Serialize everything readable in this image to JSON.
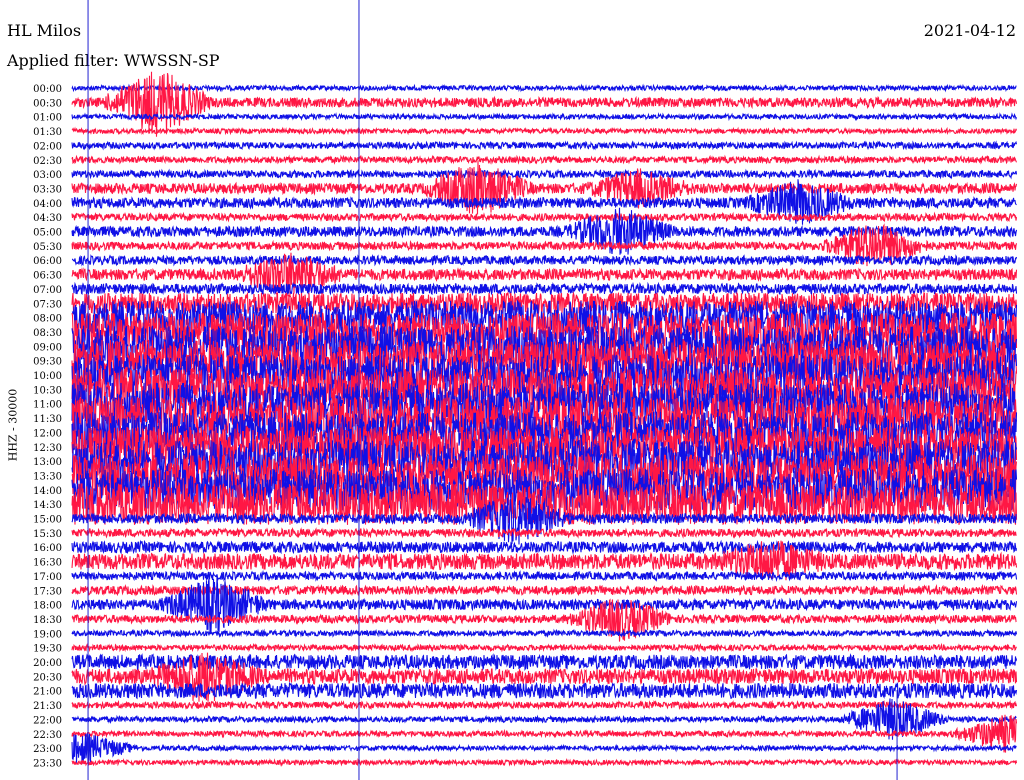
{
  "header": {
    "station": "HL Milos",
    "filter": "Applied filter: WWSSN-SP",
    "date": "2021-04-12"
  },
  "chart_data": {
    "type": "line",
    "title": "HL Milos",
    "subtitle": "Applied filter: WWSSN-SP",
    "date": "2021-04-12",
    "ylabel": "HHZ - 30000",
    "xlabel": "",
    "row_labels": [
      "00:00",
      "00:30",
      "01:00",
      "01:30",
      "02:00",
      "02:30",
      "03:00",
      "03:30",
      "04:00",
      "04:30",
      "05:00",
      "05:30",
      "06:00",
      "06:30",
      "07:00",
      "07:30",
      "08:00",
      "08:30",
      "09:00",
      "09:30",
      "10:00",
      "10:30",
      "11:00",
      "11:30",
      "12:00",
      "12:30",
      "13:00",
      "13:30",
      "14:00",
      "14:30",
      "15:00",
      "15:30",
      "16:00",
      "16:30",
      "17:00",
      "17:30",
      "18:00",
      "18:30",
      "19:00",
      "19:30",
      "20:00",
      "20:30",
      "21:00",
      "21:30",
      "22:00",
      "22:30",
      "23:00",
      "23:30"
    ],
    "row_activity": [
      0.6,
      1.2,
      0.6,
      0.6,
      0.8,
      0.8,
      0.9,
      1.3,
      1.3,
      0.9,
      1.3,
      1.0,
      1.1,
      1.4,
      1.3,
      2.6,
      4.2,
      4.8,
      5.2,
      5.2,
      5.2,
      5.2,
      5.2,
      5.2,
      5.2,
      5.2,
      5.2,
      5.2,
      5.2,
      5.2,
      1.2,
      1.0,
      1.4,
      2.0,
      1.0,
      1.1,
      1.3,
      1.0,
      0.7,
      0.7,
      1.8,
      1.9,
      1.9,
      0.8,
      0.7,
      0.7,
      0.6,
      0.6
    ],
    "events": [
      {
        "row": 1,
        "time_fraction": 0.09,
        "strength": 3.5
      },
      {
        "row": 7,
        "time_fraction": 0.43,
        "strength": 2.8
      },
      {
        "row": 7,
        "time_fraction": 0.6,
        "strength": 1.8
      },
      {
        "row": 8,
        "time_fraction": 0.77,
        "strength": 2.2
      },
      {
        "row": 10,
        "time_fraction": 0.58,
        "strength": 2.4
      },
      {
        "row": 11,
        "time_fraction": 0.85,
        "strength": 2.4
      },
      {
        "row": 13,
        "time_fraction": 0.23,
        "strength": 2.2
      },
      {
        "row": 30,
        "time_fraction": 0.47,
        "strength": 2.6
      },
      {
        "row": 33,
        "time_fraction": 0.74,
        "strength": 1.8
      },
      {
        "row": 36,
        "time_fraction": 0.15,
        "strength": 2.8
      },
      {
        "row": 37,
        "time_fraction": 0.58,
        "strength": 2.2
      },
      {
        "row": 41,
        "time_fraction": 0.14,
        "strength": 2.4
      },
      {
        "row": 44,
        "time_fraction": 0.87,
        "strength": 2.2
      },
      {
        "row": 45,
        "time_fraction": 0.99,
        "strength": 2.0
      },
      {
        "row": 46,
        "time_fraction": 0.01,
        "strength": 1.6
      }
    ],
    "colors": {
      "odd": "#1010e6",
      "even": "#ff1744",
      "marker": "#2020d0",
      "text": "#000000"
    },
    "marker_fractions": [
      0.017,
      0.304,
      0.874
    ]
  }
}
